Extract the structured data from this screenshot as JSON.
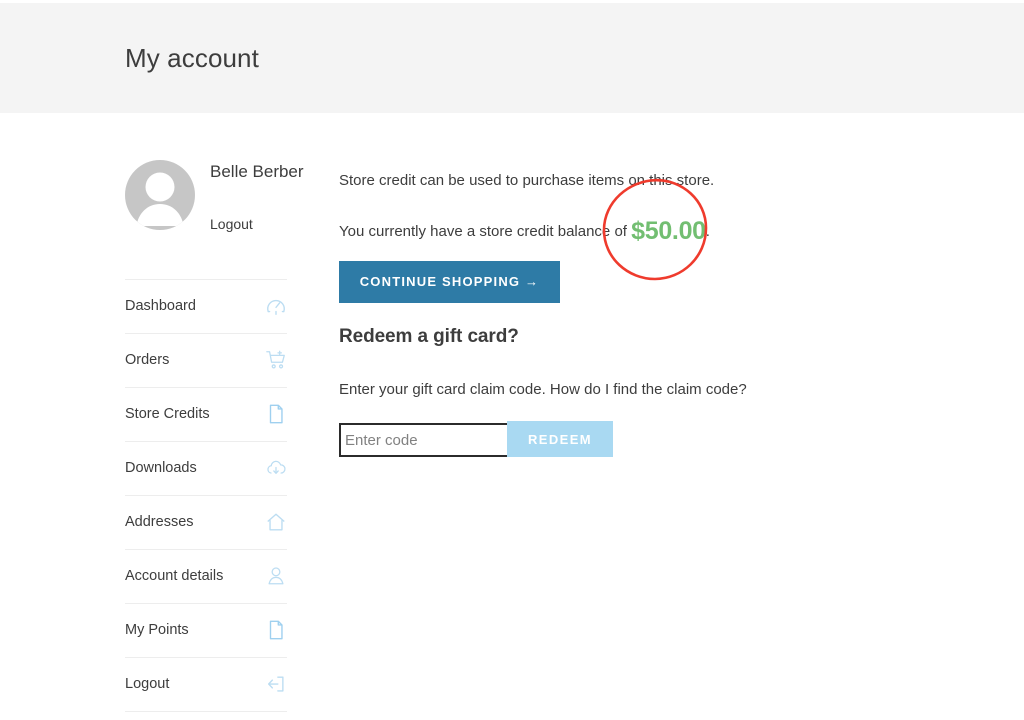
{
  "header": {
    "title": "My account"
  },
  "sidebar": {
    "profile": {
      "name": "Belle Berber",
      "logout_label": "Logout",
      "avatar_icon": "user-avatar-icon"
    },
    "items": [
      {
        "label": "Dashboard",
        "icon": "gauge-icon"
      },
      {
        "label": "Orders",
        "icon": "shopping-cart-icon"
      },
      {
        "label": "Store Credits",
        "icon": "document-icon"
      },
      {
        "label": "Downloads",
        "icon": "cloud-download-icon"
      },
      {
        "label": "Addresses",
        "icon": "home-icon"
      },
      {
        "label": "Account details",
        "icon": "person-icon"
      },
      {
        "label": "My Points",
        "icon": "document-icon"
      },
      {
        "label": "Logout",
        "icon": "logout-icon"
      }
    ]
  },
  "main": {
    "credit_info": "Store credit can be used to purchase items on this store.",
    "balance_prefix": "You currently have a store credit balance of ",
    "balance_amount": "$50.00",
    "balance_suffix": ".",
    "continue_button": "CONTINUE SHOPPING →",
    "redeem_title": "Redeem a gift card?",
    "redeem_desc": "Enter your gift card claim code. How do I find the claim code?",
    "code_placeholder": "Enter code",
    "code_value": "",
    "redeem_button": "REDEEM"
  },
  "annotation": {
    "shape": "circle-highlight",
    "color": "#ef3b2d",
    "target": "$50.00"
  },
  "colors": {
    "header_bg": "#f4f4f4",
    "primary_button": "#2e7ba6",
    "redeem_button": "#a9d9f2",
    "amount_green": "#72be71",
    "icon_blue": "#bcddf2",
    "annotation_red": "#ef3b2d"
  }
}
